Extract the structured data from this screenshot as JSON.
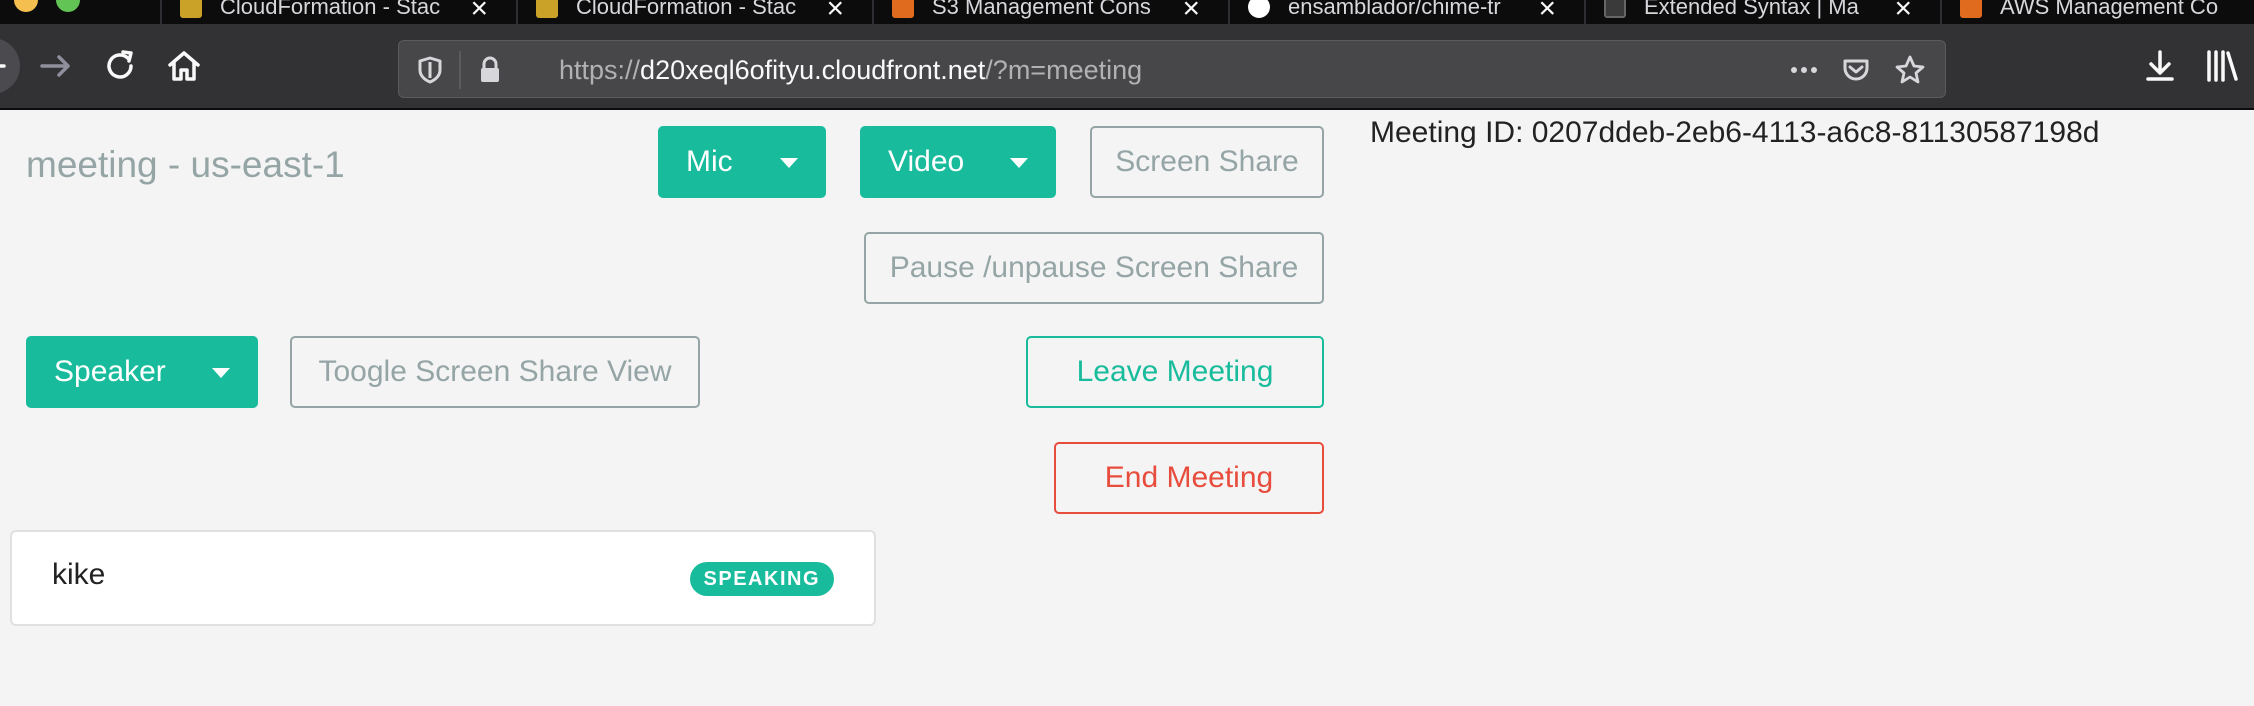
{
  "browser": {
    "tabs": [
      {
        "title": "CloudFormation - Stac",
        "favicon_color": "#c9a227"
      },
      {
        "title": "CloudFormation - Stac",
        "favicon_color": "#c9a227"
      },
      {
        "title": "S3 Management Cons",
        "favicon_color": "#e06a1d"
      },
      {
        "title": "ensamblador/chime-tr",
        "favicon_color": "#ffffff"
      },
      {
        "title": "Extended Syntax | Ma",
        "favicon_color": "#3a3a3a"
      },
      {
        "title": "AWS Management Co",
        "favicon_color": "#e06a1d"
      }
    ],
    "url": {
      "scheme": "https://",
      "domain": "d20xeql6ofityu.cloudfront.net",
      "path": "/?m=meeting"
    },
    "icons": [
      "back-icon",
      "forward-icon",
      "reload-icon",
      "home-icon",
      "shield-icon",
      "lock-icon",
      "more-icon",
      "pocket-icon",
      "star-icon",
      "download-icon",
      "library-icon"
    ]
  },
  "page": {
    "title": "meeting - us-east-1",
    "meeting_id": "Meeting ID: 0207ddeb-2eb6-4113-a6c8-81130587198d",
    "buttons": {
      "mic": "Mic",
      "video": "Video",
      "screen_share": "Screen Share",
      "pause_screen_share": "Pause /unpause Screen Share",
      "speaker": "Speaker",
      "toggle_screen_share_view": "Toogle Screen Share View",
      "leave_meeting": "Leave Meeting",
      "end_meeting": "End Meeting"
    },
    "roster": [
      {
        "name": "kike",
        "status": "SPEAKING"
      }
    ]
  },
  "colors": {
    "accent": "#18bc9c",
    "danger": "#e74c3c",
    "muted": "#95a5a6",
    "chrome_dark": "#0c0c0d",
    "chrome_toolbar": "#323234"
  }
}
